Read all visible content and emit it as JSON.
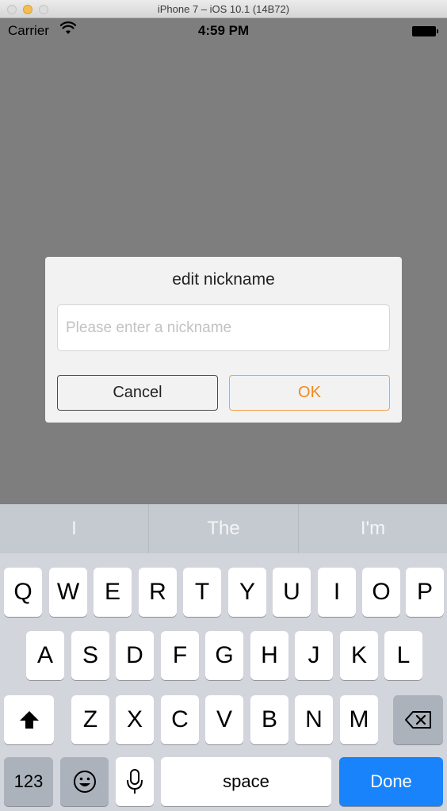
{
  "window": {
    "title": "iPhone 7 – iOS 10.1 (14B72)"
  },
  "status_bar": {
    "carrier": "Carrier",
    "time": "4:59 PM"
  },
  "dialog": {
    "title": "edit nickname",
    "input": {
      "placeholder": "Please enter a nickname",
      "value": ""
    },
    "cancel_label": "Cancel",
    "ok_label": "OK"
  },
  "keyboard": {
    "suggestions": [
      "I",
      "The",
      "I'm"
    ],
    "row1": [
      "Q",
      "W",
      "E",
      "R",
      "T",
      "Y",
      "U",
      "I",
      "O",
      "P"
    ],
    "row2": [
      "A",
      "S",
      "D",
      "F",
      "G",
      "H",
      "J",
      "K",
      "L"
    ],
    "row3": [
      "Z",
      "X",
      "C",
      "V",
      "B",
      "N",
      "M"
    ],
    "numbers_label": "123",
    "space_label": "space",
    "done_label": "Done",
    "icons": {
      "shift": "shift-arrow-icon",
      "delete": "backspace-icon",
      "emoji": "emoji-icon",
      "dictation": "microphone-icon"
    }
  },
  "colors": {
    "ok_accent": "#f08a1c",
    "done_blue": "#1883fb",
    "dim_overlay": "#7e7e7e"
  }
}
